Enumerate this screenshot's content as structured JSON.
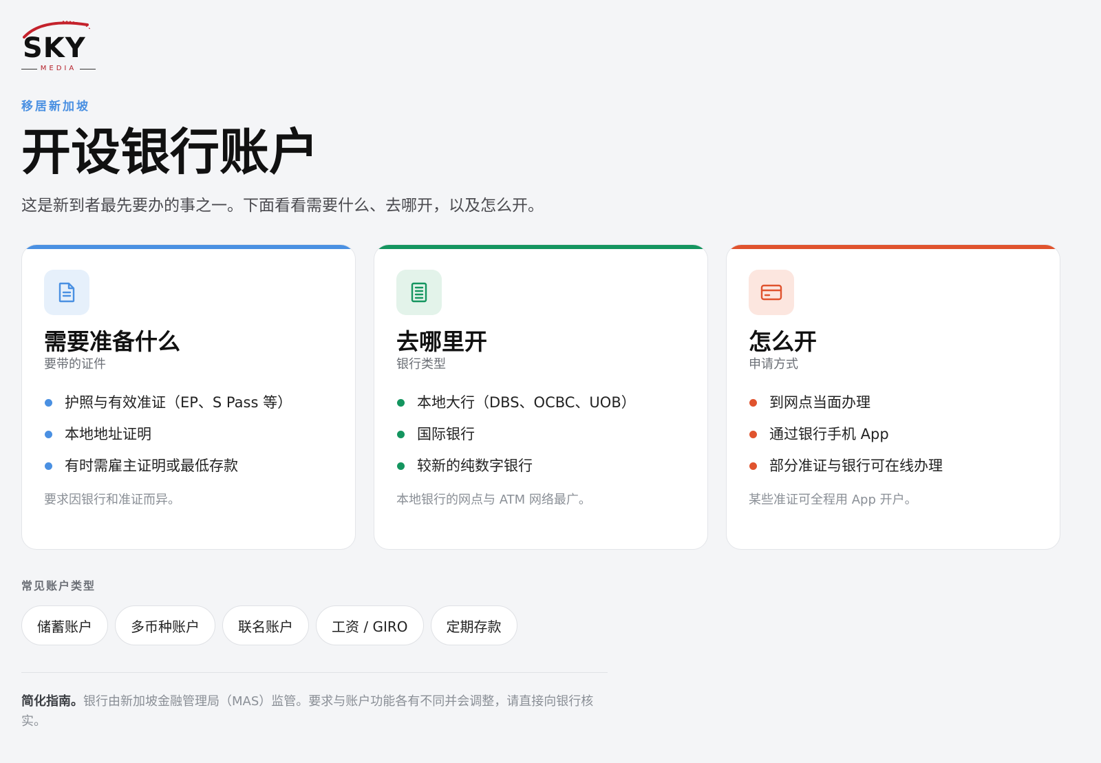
{
  "brand": {
    "logo_word": "SKY",
    "logo_sub": "MEDIA"
  },
  "eyebrow": "移居新加坡",
  "title": "开设银行账户",
  "lead": "这是新到者最先要办的事之一。下面看看需要什么、去哪开，以及怎么开。",
  "cards": [
    {
      "accent": "#4a90e2",
      "icon_bg": "#e6f0fb",
      "icon": "document-icon",
      "title": "需要准备什么",
      "subtitle": "要带的证件",
      "items": [
        "护照与有效准证（EP、S Pass 等）",
        "本地地址证明",
        "有时需雇主证明或最低存款"
      ],
      "note": "要求因银行和准证而异。"
    },
    {
      "accent": "#14955f",
      "icon_bg": "#e3f3ea",
      "icon": "building-list-icon",
      "title": "去哪里开",
      "subtitle": "银行类型",
      "items": [
        "本地大行（DBS、OCBC、UOB）",
        "国际银行",
        "较新的纯数字银行"
      ],
      "note": "本地银行的网点与 ATM 网络最广。"
    },
    {
      "accent": "#e0532e",
      "icon_bg": "#fce6df",
      "icon": "credit-card-icon",
      "title": "怎么开",
      "subtitle": "申请方式",
      "items": [
        "到网点当面办理",
        "通过银行手机 App",
        "部分准证与银行可在线办理"
      ],
      "note": "某些准证可全程用 App 开户。"
    }
  ],
  "account_types": {
    "label": "常见账户类型",
    "chips": [
      "储蓄账户",
      "多币种账户",
      "联名账户",
      "工资 / GIRO",
      "定期存款"
    ]
  },
  "footer": {
    "bold": "简化指南。",
    "text": "银行由新加坡金融管理局（MAS）监管。要求与账户功能各有不同并会调整，请直接向银行核实。"
  }
}
